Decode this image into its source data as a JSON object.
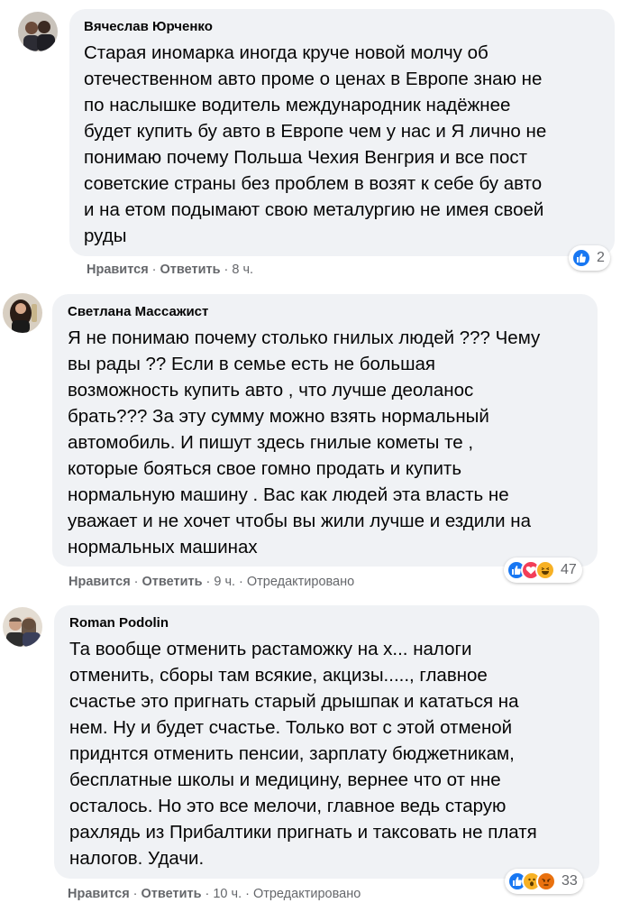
{
  "comments": [
    {
      "author": "Вячеслав Юрченко",
      "lines": [
        "Старая иномарка иногда круче новой молчу об",
        "отечественном авто проме о ценах в Европе знаю не",
        "по наслышке водитель международник надёжнее",
        "будет купить бу авто в Европе чем у нас и Я лично не",
        "понимаю почему Польша Чехия Венгрия и все пост",
        "советские страны без проблем в возят к себе бу авто",
        "и на етом подымают свою металургию не имея своей",
        "руды"
      ],
      "like": "Нравится",
      "reply": "Ответить",
      "time": "8 ч.",
      "edited": "",
      "reactions": [
        "like"
      ],
      "reaction_count": "2"
    },
    {
      "author": "Светлана Массажист",
      "lines": [
        "Я не понимаю почему столько гнилых людей ??? Чему",
        "вы рады ?? Если в семье есть не большая",
        "возможность купить авто , что лучше деоланос",
        "брать??? За эту сумму можно взять нормальный",
        "автомобиль. И пишут здесь гнилые кометы те ,",
        "которые бояться свое гомно продать и купить",
        "нормальную машину . Вас как людей эта власть не",
        "уважает и не хочет чтобы вы жили лучше и ездили на",
        "нормальных машинах"
      ],
      "like": "Нравится",
      "reply": "Ответить",
      "time": "9 ч.",
      "edited": "Отредактировано",
      "reactions": [
        "like",
        "love",
        "haha"
      ],
      "reaction_count": "47"
    },
    {
      "author": "Roman Podolin",
      "lines": [
        "Та вообще отменить растаможку на х... налоги",
        "отменить, сборы там всякие, акцизы....., главное",
        "счастье это пригнать старый дрышпак и кататься на",
        "нем. Ну и будет счастье. Только вот с этой отменой",
        "приднтся отменить пенсии, зарплату бюджетникам,",
        "бесплатные школы и медицину, вернее что от нне",
        "осталось. Но это все мелочи, главное ведь старую",
        "рахлядь из Прибалтики пригнать и таксовать не платя",
        "налогов. Удачи."
      ],
      "like": "Нравится",
      "reply": "Ответить",
      "time": "10 ч.",
      "edited": "Отредактировано",
      "reactions": [
        "like",
        "wow",
        "angry"
      ],
      "reaction_count": "33"
    }
  ],
  "separator": "·",
  "colors": {
    "bubble": "#f0f2f5",
    "like": "#1877f2",
    "love": "#f33e58",
    "haha": "#f7b125",
    "angry": "#e9710f",
    "meta": "#65676b"
  }
}
